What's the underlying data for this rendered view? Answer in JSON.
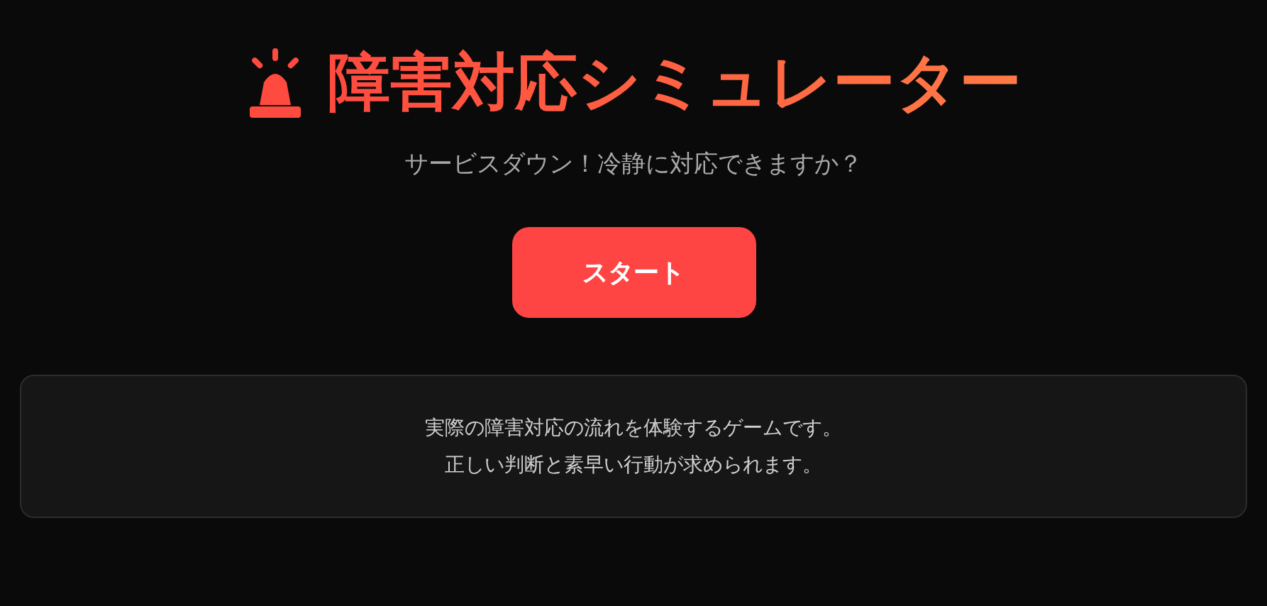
{
  "title": "障害対応シミュレーター",
  "subtitle": "サービスダウン！冷静に対応できますか？",
  "start_button": "スタート",
  "description": [
    "実際の障害対応の流れを体験するゲームです。",
    "正しい判断と素早い行動が求められます。"
  ]
}
